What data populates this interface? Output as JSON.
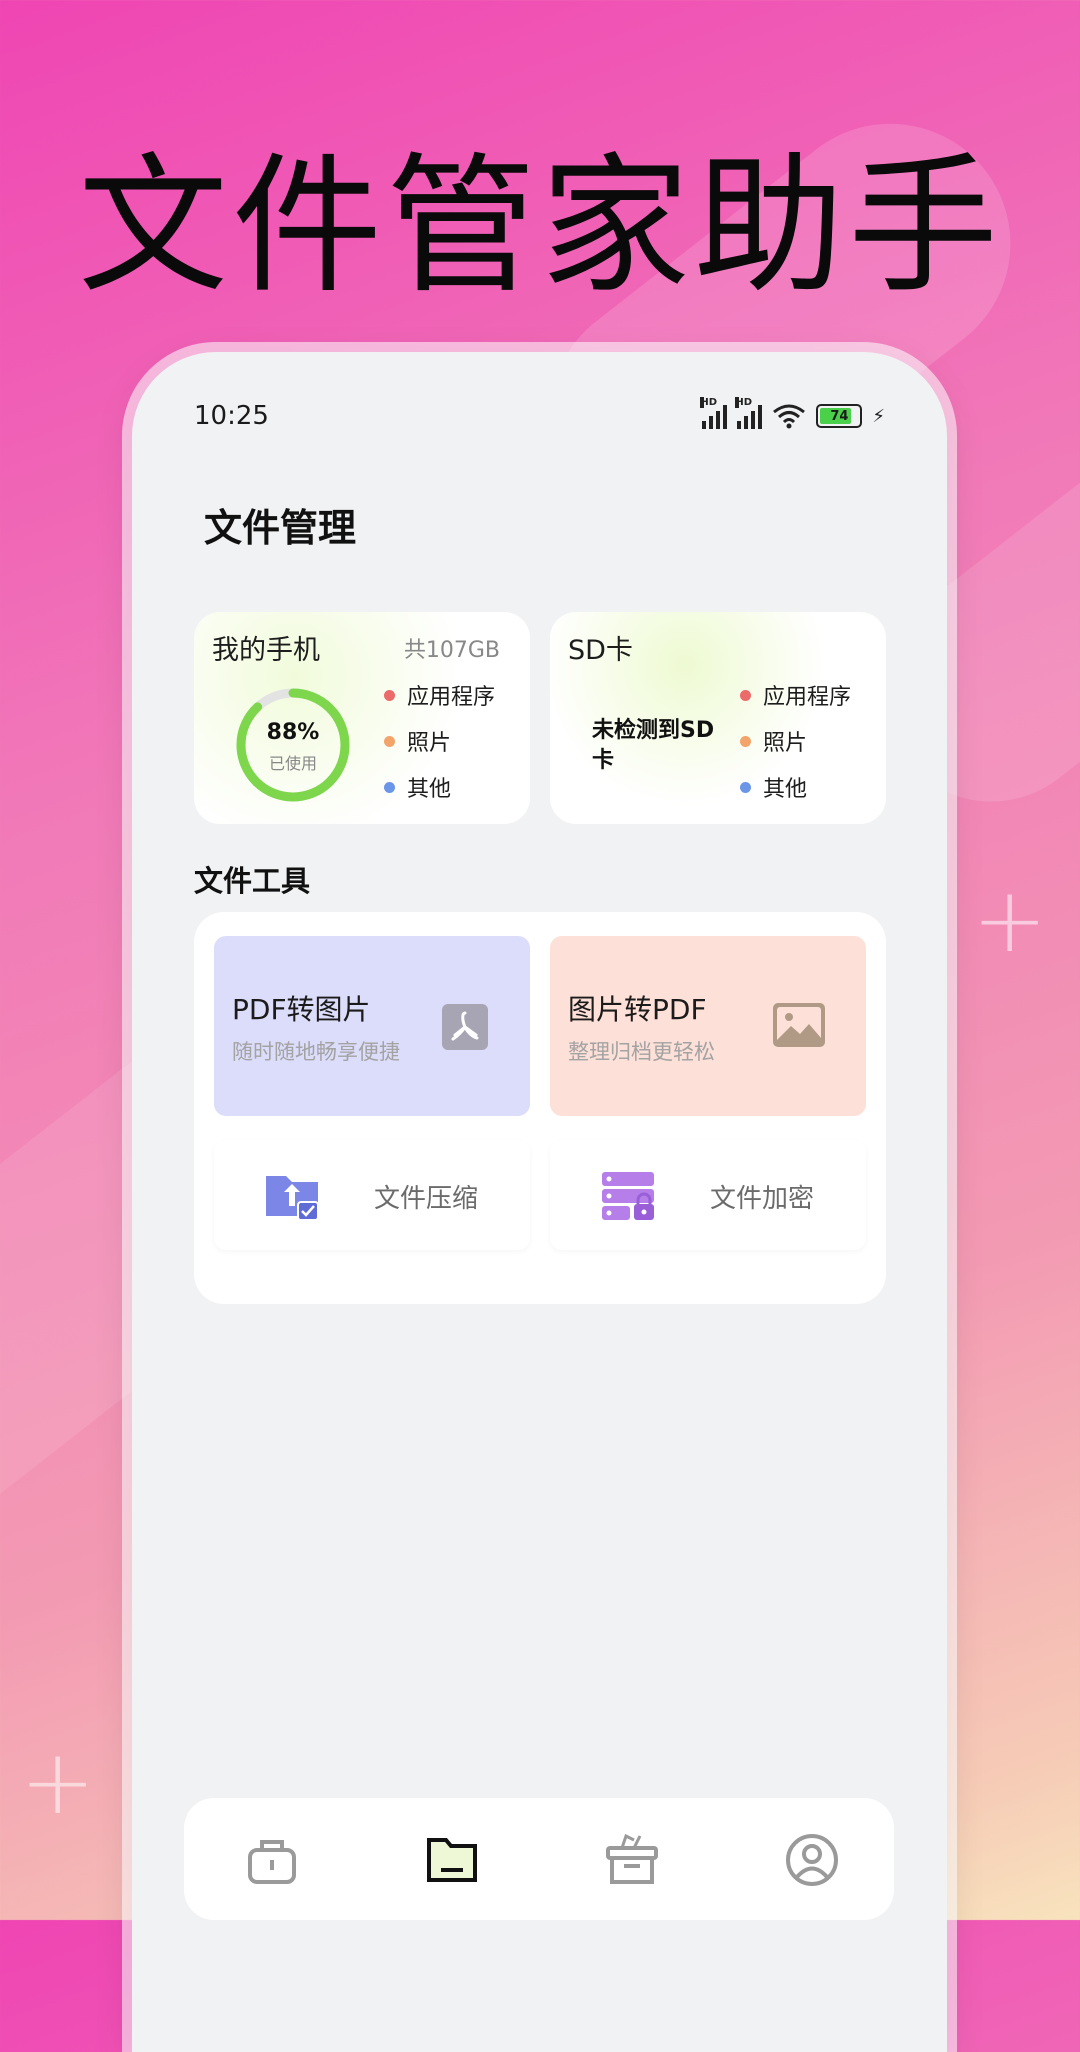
{
  "headline": "文件管家助手",
  "statusbar": {
    "time": "10:25",
    "hd": "HD",
    "battery": "74"
  },
  "page_title": "文件管理",
  "storage": {
    "phone": {
      "title": "我的手机",
      "total": "共107GB",
      "percent": "88%",
      "percent_value": 88,
      "used_label": "已使用",
      "legend": [
        {
          "label": "应用程序",
          "color": "#ec6a6a"
        },
        {
          "label": "照片",
          "color": "#f2a46a"
        },
        {
          "label": "其他",
          "color": "#6b96e8"
        }
      ]
    },
    "sd": {
      "title": "SD卡",
      "message": "未检测到SD卡",
      "legend": [
        {
          "label": "应用程序",
          "color": "#ec6a6a"
        },
        {
          "label": "照片",
          "color": "#f2a46a"
        },
        {
          "label": "其他",
          "color": "#6b96e8"
        }
      ]
    }
  },
  "tools_section": {
    "title": "文件工具",
    "pdf_to_image": {
      "name": "PDF转图片",
      "desc": "随时随地畅享便捷"
    },
    "image_to_pdf": {
      "name": "图片转PDF",
      "desc": "整理归档更轻松"
    },
    "compress": {
      "name": "文件压缩"
    },
    "encrypt": {
      "name": "文件加密"
    }
  },
  "colors": {
    "ring": "#7dd64b",
    "ring_track": "#e3e3e3",
    "pdf_bg": "#dcdcfb",
    "img_bg": "#fde0d7"
  },
  "navbar": {
    "items": [
      "toolbox-icon",
      "folder-icon",
      "box-icon",
      "profile-icon"
    ],
    "active": 1
  }
}
